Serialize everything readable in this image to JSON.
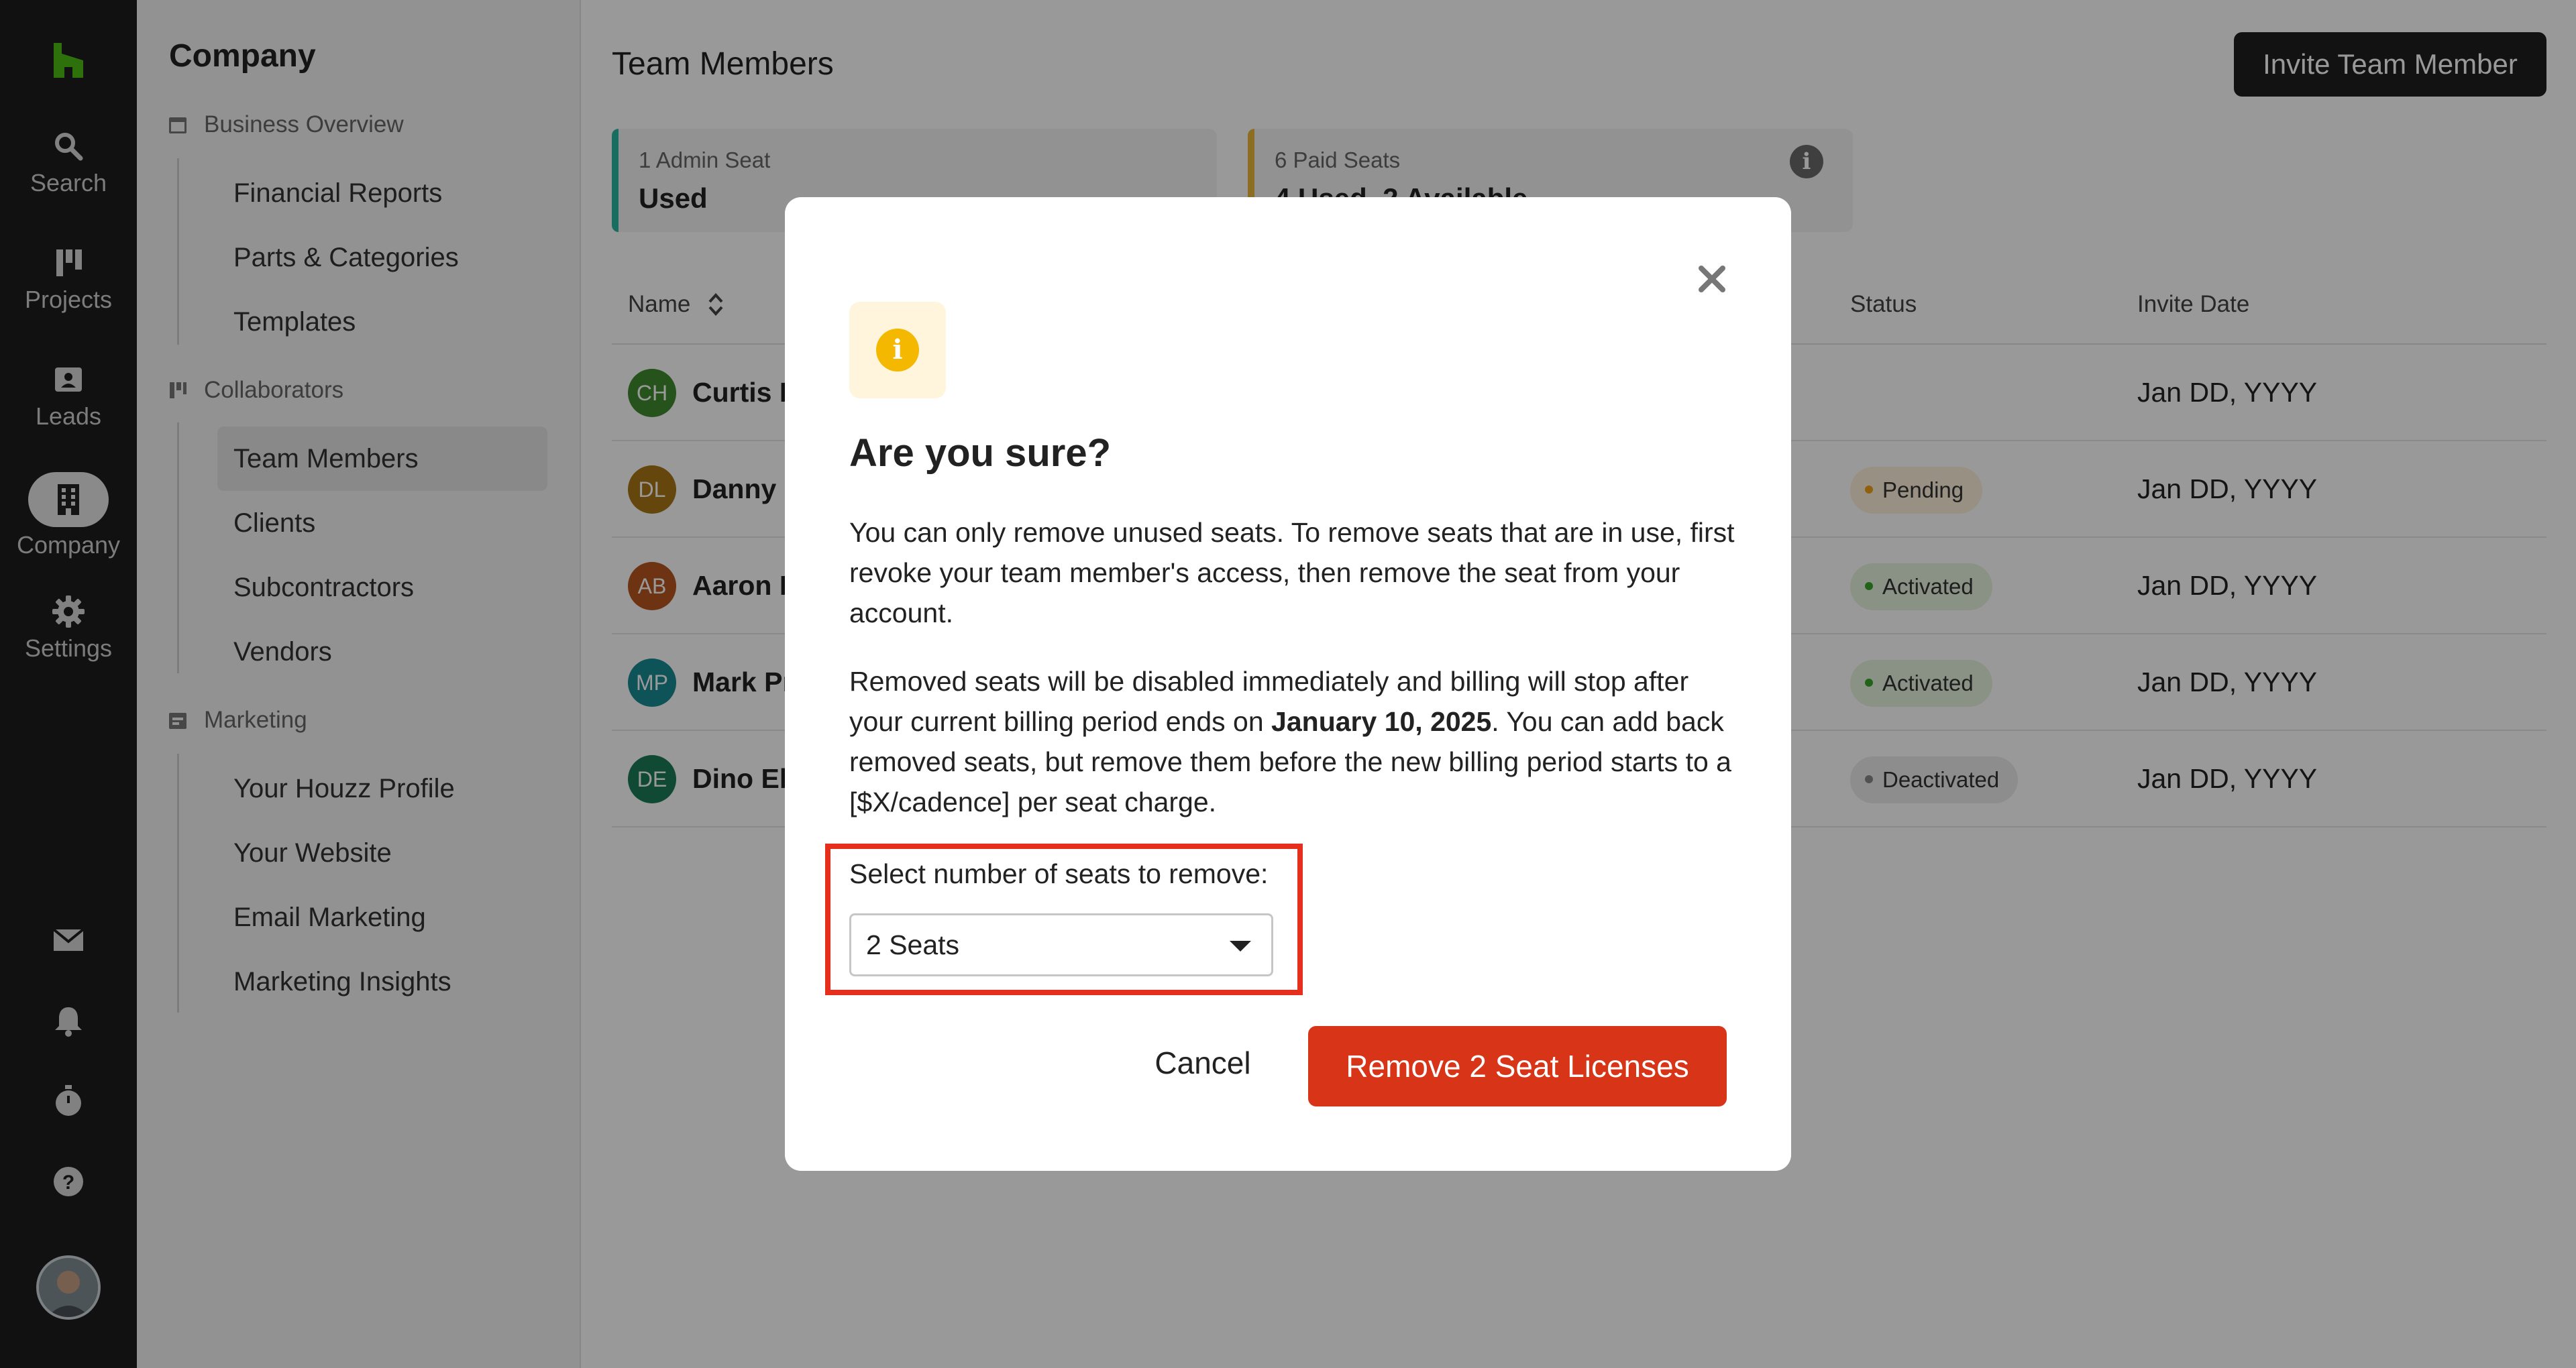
{
  "rail": {
    "items": [
      {
        "label": "Search",
        "icon": "search-icon"
      },
      {
        "label": "Projects",
        "icon": "projects-icon"
      },
      {
        "label": "Leads",
        "icon": "leads-icon"
      },
      {
        "label": "Company",
        "icon": "company-icon"
      },
      {
        "label": "Settings",
        "icon": "gear-icon"
      }
    ],
    "bottom_icons": [
      "inbox-icon",
      "bell-icon",
      "timer-icon",
      "help-icon"
    ]
  },
  "sidebar": {
    "title": "Company",
    "groups": [
      {
        "label": "Business Overview",
        "items": [
          "Financial Reports",
          "Parts & Categories",
          "Templates"
        ]
      },
      {
        "label": "Collaborators",
        "items": [
          "Team Members",
          "Clients",
          "Subcontractors",
          "Vendors"
        ]
      },
      {
        "label": "Marketing",
        "items": [
          "Your Houzz Profile",
          "Your Website",
          "Email Marketing",
          "Marketing Insights"
        ]
      }
    ],
    "active_item": "Team Members"
  },
  "main": {
    "title": "Team Members",
    "invite_label": "Invite Team Member",
    "cards": [
      {
        "line1": "1 Admin Seat",
        "line2": "Used",
        "accent": "#2bb5a0"
      },
      {
        "line1": "6 Paid Seats",
        "line2": "4 Used, 2 Available",
        "accent": "#e8b83a"
      }
    ],
    "table": {
      "headers": {
        "name": "Name",
        "status": "Status",
        "invite_date": "Invite Date"
      },
      "rows": [
        {
          "initials": "CH",
          "name": "Curtis H",
          "status": "",
          "date": "Jan DD, YYYY",
          "color": "#3f8a2e"
        },
        {
          "initials": "DL",
          "name": "Danny L",
          "status": "Pending",
          "date": "Jan DD, YYYY",
          "color": "#a87514"
        },
        {
          "initials": "AB",
          "name": "Aaron B",
          "status": "Activated",
          "date": "Jan DD, YYYY",
          "color": "#b8561e"
        },
        {
          "initials": "MP",
          "name": "Mark Pr",
          "status": "Activated",
          "date": "Jan DD, YYYY",
          "color": "#178a91"
        },
        {
          "initials": "DE",
          "name": "Dino Eb",
          "status": "Deactivated",
          "date": "Jan DD, YYYY",
          "color": "#1b7a57"
        }
      ]
    }
  },
  "modal": {
    "title": "Are you sure?",
    "para1": "You can only remove unused seats. To remove seats that are in use, first revoke your team member's access, then remove the seat from your account.",
    "para2_a": "Removed seats will be disabled immediately and billing will stop after your current billing period ends on ",
    "para2_date": "January 10, 2025",
    "para2_b": ". You can add back removed seats, but remove them before the new billing period starts to a [$X/cadence] per seat charge.",
    "select_label": "Select number of seats to remove:",
    "select_value": "2 Seats",
    "cancel_label": "Cancel",
    "confirm_label": "Remove 2 Seat Licenses",
    "confirm_color": "#d83417",
    "highlight_color": "#e62e1c"
  }
}
